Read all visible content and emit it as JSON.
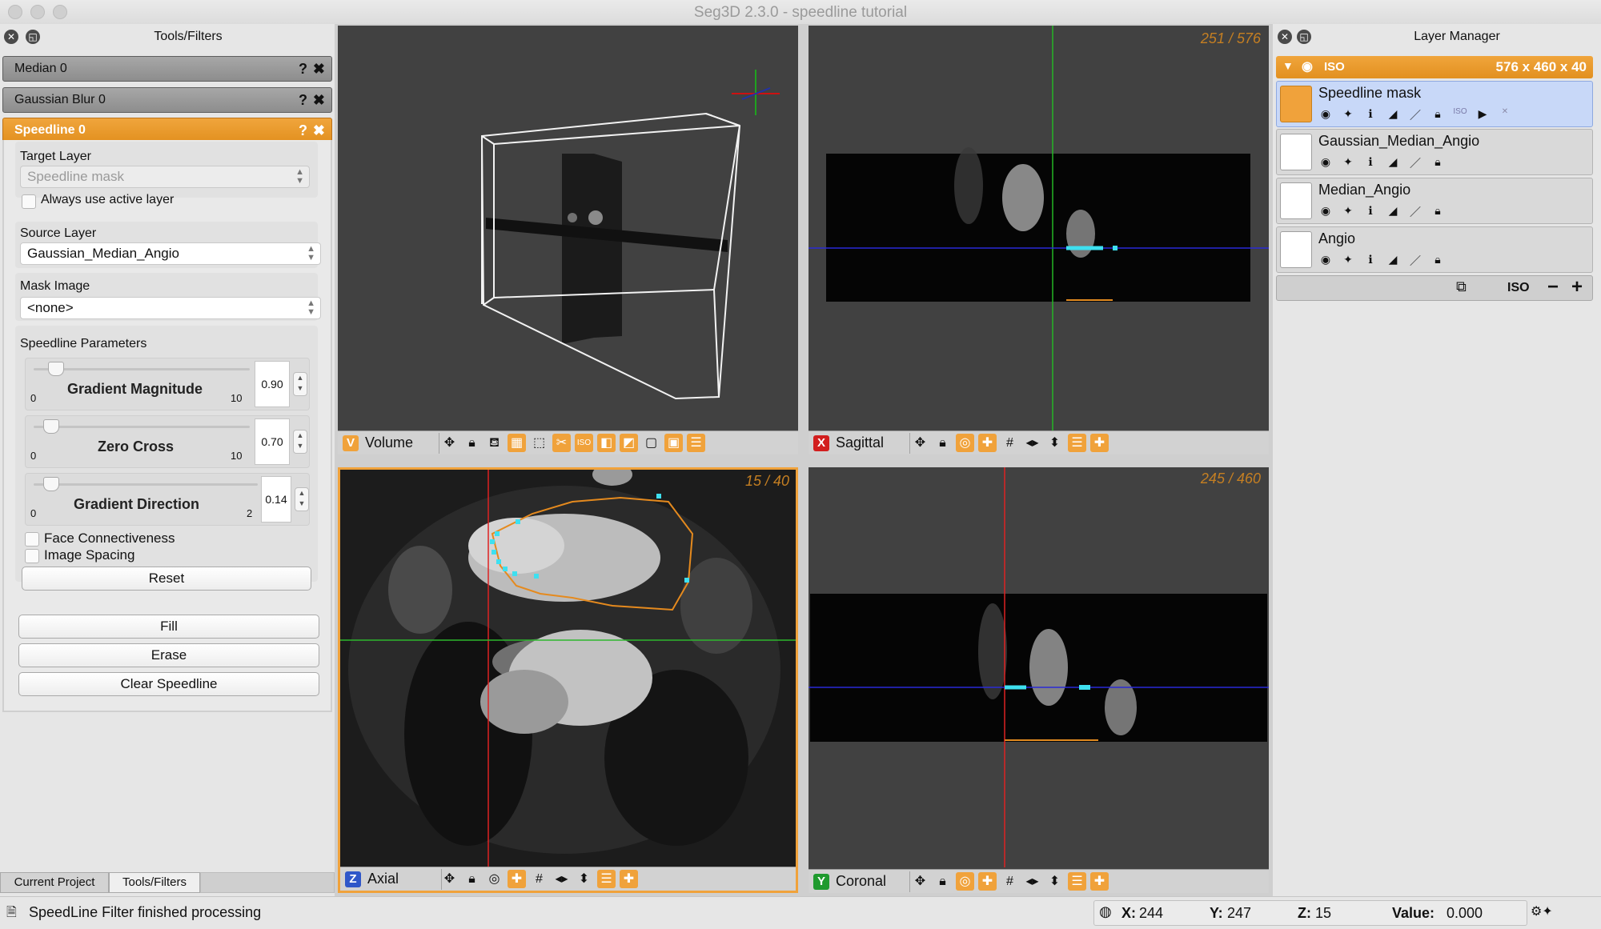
{
  "window": {
    "title": "Seg3D 2.3.0 - speedline tutorial"
  },
  "left_panel": {
    "title": "Tools/Filters",
    "tools": [
      {
        "name": "Median 0"
      },
      {
        "name": "Gaussian Blur 0"
      },
      {
        "name": "Speedline 0"
      }
    ],
    "speedline": {
      "target_layer_label": "Target Layer",
      "target_layer_value": "Speedline mask",
      "always_active_label": "Always use active layer",
      "source_layer_label": "Source Layer",
      "source_layer_value": "Gaussian_Median_Angio",
      "mask_image_label": "Mask Image",
      "mask_image_value": "<none>",
      "params_label": "Speedline Parameters",
      "sliders": [
        {
          "name": "Gradient Magnitude",
          "min": "0",
          "max": "10",
          "value": "0.90",
          "fraction": 0.09
        },
        {
          "name": "Zero Cross",
          "min": "0",
          "max": "10",
          "value": "0.70",
          "fraction": 0.07
        },
        {
          "name": "Gradient Direction",
          "min": "0",
          "max": "2",
          "value": "0.14",
          "fraction": 0.07
        }
      ],
      "face_connectiveness_label": "Face Connectiveness",
      "image_spacing_label": "Image Spacing",
      "reset_label": "Reset",
      "fill_label": "Fill",
      "erase_label": "Erase",
      "clear_label": "Clear Speedline"
    },
    "tabs": [
      "Current Project",
      "Tools/Filters"
    ]
  },
  "viewers": {
    "volume": {
      "badge": "V",
      "name": "Volume"
    },
    "sagittal": {
      "badge": "X",
      "name": "Sagittal",
      "slice": "251 / 576"
    },
    "axial": {
      "badge": "Z",
      "name": "Axial",
      "slice": "15 / 40"
    },
    "coronal": {
      "badge": "Y",
      "name": "Coronal",
      "slice": "245 / 460"
    }
  },
  "layer_manager": {
    "title": "Layer Manager",
    "group": {
      "label": "ISO",
      "dims": "576 x 460 x 40"
    },
    "layers": [
      {
        "name": "Speedline mask",
        "active": true
      },
      {
        "name": "Gaussian_Median_Angio",
        "active": false
      },
      {
        "name": "Median_Angio",
        "active": false
      },
      {
        "name": "Angio",
        "active": false
      }
    ],
    "footer_iso": "ISO"
  },
  "status": {
    "message": "SpeedLine Filter finished processing",
    "x_label": "X:",
    "x_value": "244",
    "y_label": "Y:",
    "y_value": "247",
    "z_label": "Z:",
    "z_value": "15",
    "value_label": "Value:",
    "value_value": "0.000"
  },
  "colors": {
    "accent": "#f0a23b",
    "active_layer": "#c8d8f8",
    "viewer_bg": "#414141"
  }
}
